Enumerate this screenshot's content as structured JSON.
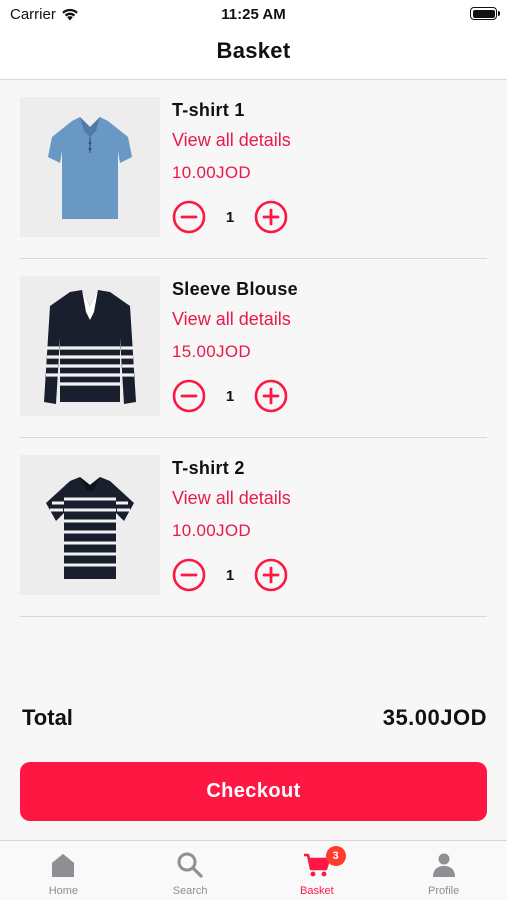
{
  "status_bar": {
    "carrier": "Carrier",
    "time": "11:25 AM"
  },
  "header": {
    "title": "Basket"
  },
  "items": [
    {
      "name": "T-shirt 1",
      "details_link": "View all details",
      "price": "10.00JOD",
      "quantity": "1",
      "image_icon": "blue-polo-shirt"
    },
    {
      "name": "Sleeve Blouse",
      "details_link": "View all details",
      "price": "15.00JOD",
      "quantity": "1",
      "image_icon": "navy-striped-sweater"
    },
    {
      "name": "T-shirt 2",
      "details_link": "View all details",
      "price": "10.00JOD",
      "quantity": "1",
      "image_icon": "navy-striped-tshirt"
    }
  ],
  "summary": {
    "total_label": "Total",
    "total_value": "35.00JOD"
  },
  "checkout": {
    "label": "Checkout"
  },
  "tabs": [
    {
      "label": "Home",
      "icon": "home-icon",
      "active": false
    },
    {
      "label": "Search",
      "icon": "search-icon",
      "active": false
    },
    {
      "label": "Basket",
      "icon": "cart-icon",
      "active": true,
      "badge": "3"
    },
    {
      "label": "Profile",
      "icon": "person-icon",
      "active": false
    }
  ],
  "colors": {
    "accent": "#ff1744",
    "link": "#e8194b",
    "inactive_tab": "#8e8e93",
    "badge": "#ff3b30"
  }
}
